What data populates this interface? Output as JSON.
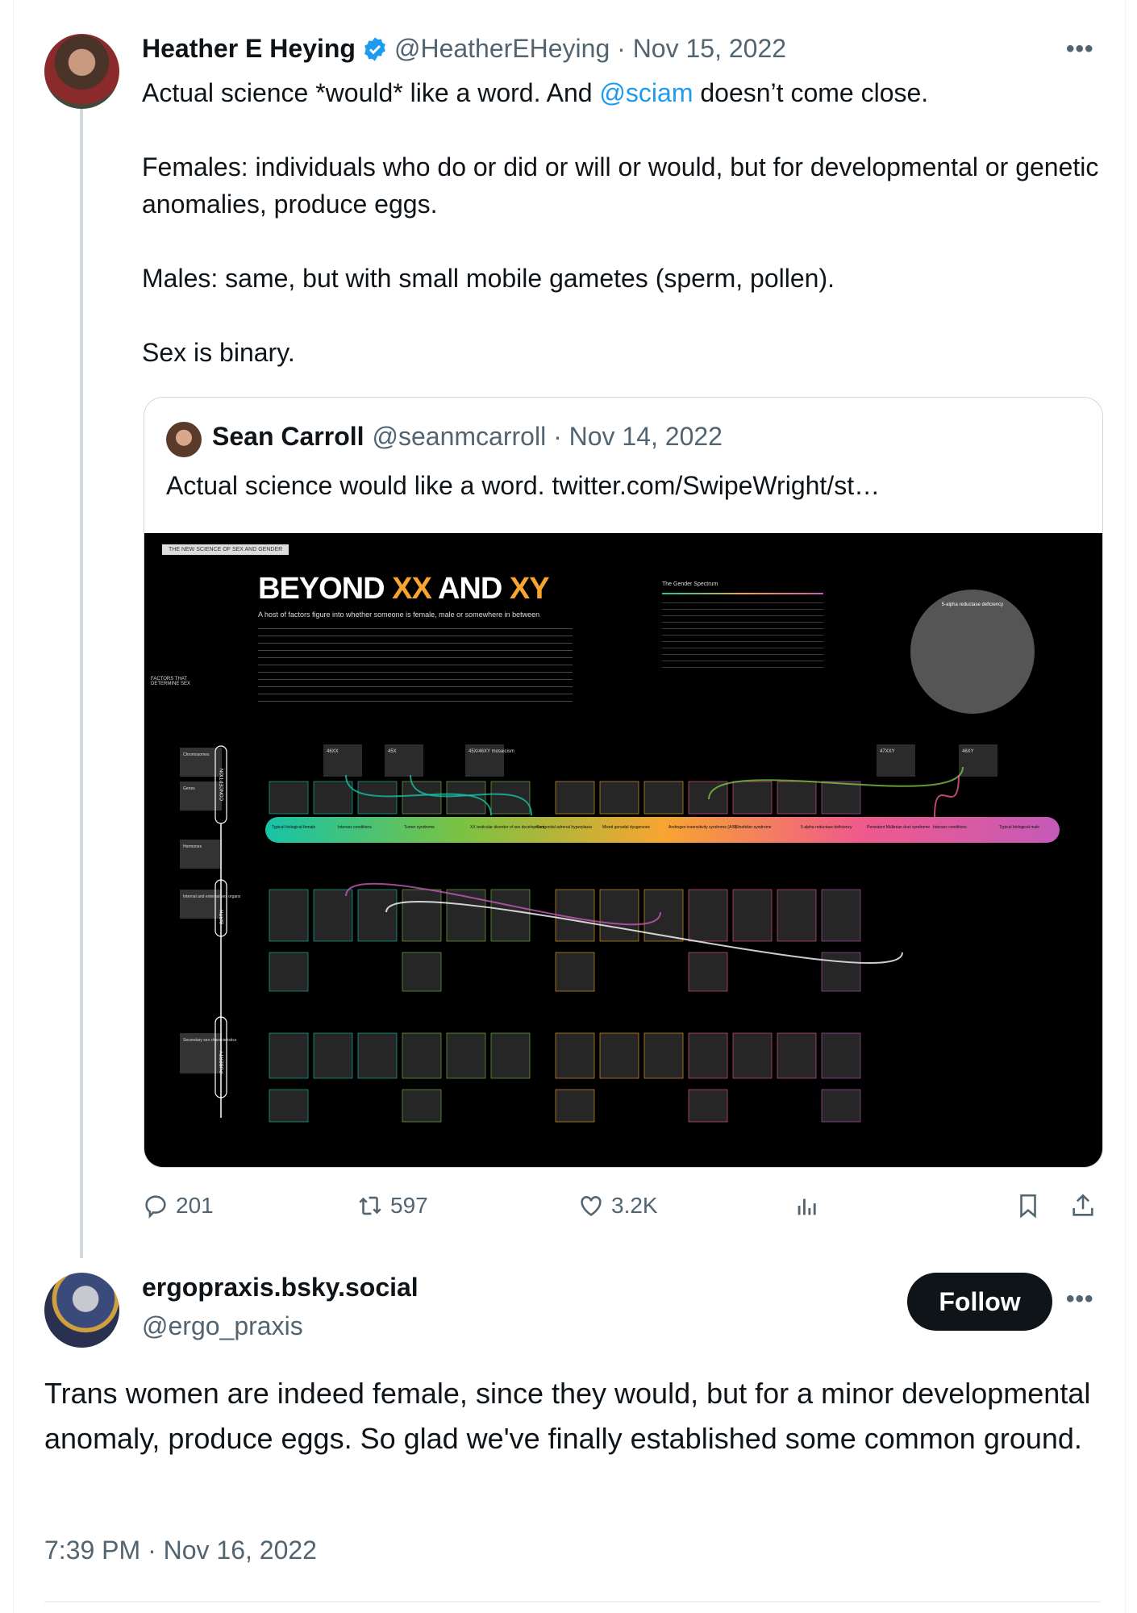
{
  "main_tweet": {
    "author_name": "Heather E Heying",
    "verified": true,
    "handle_date": "@HeatherEHeying · Nov 15, 2022",
    "line1_before": "Actual science *would* like a word. And ",
    "line1_mention": "@sciam",
    "line1_after": " doesn’t come close.",
    "para2": "Females: individuals who do or did or will or would, but for developmental or genetic anomalies, produce eggs.",
    "para3": "Males: same, but with small mobile  gametes (sperm, pollen).",
    "para4": "Sex is binary.",
    "quoted": {
      "author_name": "Sean Carroll",
      "handle_date": "@seanmcarroll · Nov 14, 2022",
      "text": "Actual science would like a word.  twitter.com/SwipeWright/st…",
      "infographic": {
        "tag": "THE NEW SCIENCE OF SEX AND GENDER",
        "title_a": "BEYOND ",
        "title_b": "XX",
        "title_c": " AND ",
        "title_d": "XY",
        "subtitle": "A host of factors figure into whether someone is female, male or somewhere in between",
        "spectrum_heading": "The Gender Spectrum",
        "circle_heading": "5-alpha reductase deficiency",
        "factors_heading": "FACTORS THAT DETERMINE SEX",
        "rows": [
          "Chromosomes",
          "Genes",
          "Hormones",
          "Internal and external sex organs",
          "Secondary sex characteristics"
        ],
        "stages": [
          "CONCEPTION",
          "BIRTH",
          "PUBERTY"
        ],
        "chromosome_boxes": [
          "46XX",
          "45X",
          "45X/46XY mosaicism",
          "47XXY",
          "46XY"
        ],
        "band_labels": [
          "Typical biological female",
          "Intersex conditions",
          "Turner syndrome",
          "XX testicular disorder of sex development",
          "Congenital adrenal hyperplasia",
          "Mixed gonadal dysgenesis",
          "Androgen insensitivity syndrome (AIS)",
          "Klinefelter syndrome",
          "5-alpha reductase deficiency",
          "Persistent Müllerian duct syndrome",
          "Intersex conditions",
          "Typical biological male"
        ],
        "accent_colors": [
          "#17c3a8",
          "#7cc242",
          "#f7a531",
          "#f05a8c",
          "#c45ab8"
        ]
      }
    },
    "actions": {
      "replies": "201",
      "reposts": "597",
      "likes": "3.2K"
    }
  },
  "reply": {
    "author_name": "ergopraxis.bsky.social",
    "handle": "@ergo_praxis",
    "follow_label": "Follow",
    "text": "Trans women are indeed female, since they would, but for a minor developmental anomaly, produce eggs. So glad we've finally established some common ground.",
    "timestamp": "7:39 PM · Nov 16, 2022"
  }
}
